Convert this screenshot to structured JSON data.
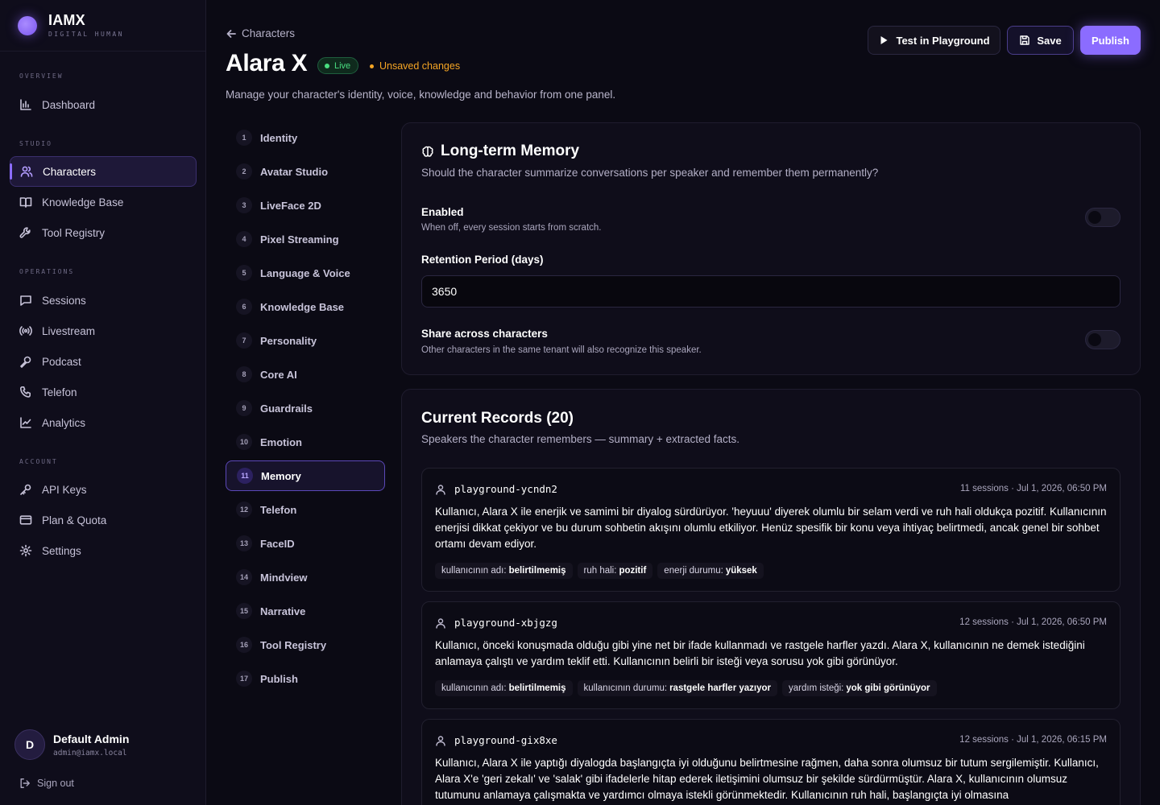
{
  "brand": {
    "name": "IAMX",
    "subtitle": "DIGITAL HUMAN"
  },
  "sidebar": {
    "sections": {
      "overview": "OVERVIEW",
      "studio": "STUDIO",
      "operations": "OPERATIONS",
      "account": "ACCOUNT"
    },
    "items": [
      {
        "label": "Dashboard",
        "icon": "bar-chart-icon"
      },
      {
        "label": "Characters",
        "icon": "users-icon",
        "active": true
      },
      {
        "label": "Knowledge Base",
        "icon": "book-icon"
      },
      {
        "label": "Tool Registry",
        "icon": "wrench-icon"
      },
      {
        "label": "Sessions",
        "icon": "chat-icon"
      },
      {
        "label": "Livestream",
        "icon": "broadcast-icon"
      },
      {
        "label": "Podcast",
        "icon": "microphone-icon"
      },
      {
        "label": "Telefon",
        "icon": "phone-icon"
      },
      {
        "label": "Analytics",
        "icon": "line-chart-icon"
      },
      {
        "label": "API Keys",
        "icon": "key-icon"
      },
      {
        "label": "Plan & Quota",
        "icon": "credit-card-icon"
      },
      {
        "label": "Settings",
        "icon": "gear-icon"
      }
    ],
    "user": {
      "initial": "D",
      "name": "Default Admin",
      "email": "admin@iamx.local"
    },
    "signout": "Sign out"
  },
  "header": {
    "back": "Characters",
    "title": "Alara X",
    "live_badge": "Live",
    "unsaved": "Unsaved changes",
    "description": "Manage your character's identity, voice, knowledge and behavior from one panel.",
    "buttons": {
      "playground": "Test in Playground",
      "save": "Save",
      "publish": "Publish"
    }
  },
  "steps": [
    {
      "num": "1",
      "label": "Identity"
    },
    {
      "num": "2",
      "label": "Avatar Studio"
    },
    {
      "num": "3",
      "label": "LiveFace 2D"
    },
    {
      "num": "4",
      "label": "Pixel Streaming"
    },
    {
      "num": "5",
      "label": "Language & Voice"
    },
    {
      "num": "6",
      "label": "Knowledge Base"
    },
    {
      "num": "7",
      "label": "Personality"
    },
    {
      "num": "8",
      "label": "Core AI"
    },
    {
      "num": "9",
      "label": "Guardrails"
    },
    {
      "num": "10",
      "label": "Emotion"
    },
    {
      "num": "11",
      "label": "Memory",
      "active": true
    },
    {
      "num": "12",
      "label": "Telefon"
    },
    {
      "num": "13",
      "label": "FaceID"
    },
    {
      "num": "14",
      "label": "Mindview"
    },
    {
      "num": "15",
      "label": "Narrative"
    },
    {
      "num": "16",
      "label": "Tool Registry"
    },
    {
      "num": "17",
      "label": "Publish"
    }
  ],
  "memory": {
    "title": "Long-term Memory",
    "subtitle": "Should the character summarize conversations per speaker and remember them permanently?",
    "enabled": {
      "label": "Enabled",
      "help": "When off, every session starts from scratch.",
      "value": false
    },
    "retention": {
      "label": "Retention Period (days)",
      "value": "3650"
    },
    "share": {
      "label": "Share across characters",
      "help": "Other characters in the same tenant will also recognize this speaker.",
      "value": false
    }
  },
  "records": {
    "title": "Current Records (20)",
    "subtitle": "Speakers the character remembers — summary + extracted facts.",
    "items": [
      {
        "id": "playground-ycndn2",
        "meta": "11 sessions · Jul 1, 2026, 06:50 PM",
        "summary": "Kullanıcı, Alara X ile enerjik ve samimi bir diyalog sürdürüyor. 'heyuuu' diyerek olumlu bir selam verdi ve ruh hali oldukça pozitif. Kullanıcının enerjisi dikkat çekiyor ve bu durum sohbetin akışını olumlu etkiliyor. Henüz spesifik bir konu veya ihtiyaç belirtmedi, ancak genel bir sohbet ortamı devam ediyor.",
        "tags": [
          {
            "key": "kullanıcının adı:",
            "value": "belirtilmemiş"
          },
          {
            "key": "ruh hali:",
            "value": "pozitif"
          },
          {
            "key": "enerji durumu:",
            "value": "yüksek"
          }
        ]
      },
      {
        "id": "playground-xbjgzg",
        "meta": "12 sessions · Jul 1, 2026, 06:50 PM",
        "summary": "Kullanıcı, önceki konuşmada olduğu gibi yine net bir ifade kullanmadı ve rastgele harfler yazdı. Alara X, kullanıcının ne demek istediğini anlamaya çalıştı ve yardım teklif etti. Kullanıcının belirli bir isteği veya sorusu yok gibi görünüyor.",
        "tags": [
          {
            "key": "kullanıcının adı:",
            "value": "belirtilmemiş"
          },
          {
            "key": "kullanıcının durumu:",
            "value": "rastgele harfler yazıyor"
          },
          {
            "key": "yardım isteği:",
            "value": "yok gibi görünüyor"
          }
        ]
      },
      {
        "id": "playground-gix8xe",
        "meta": "12 sessions · Jul 1, 2026, 06:15 PM",
        "summary": "Kullanıcı, Alara X ile yaptığı diyalogda başlangıçta iyi olduğunu belirtmesine rağmen, daha sonra olumsuz bir tutum sergilemiştir. Kullanıcı, Alara X'e 'geri zekalı' ve 'salak' gibi ifadelerle hitap ederek iletişimini olumsuz bir şekilde sürdürmüştür. Alara X, kullanıcının olumsuz tutumunu anlamaya çalışmakta ve yardımcı olmaya istekli görünmektedir. Kullanıcının ruh hali, başlangıçta iyi olmasına",
        "tags": []
      }
    ]
  },
  "colors": {
    "accent": "#8b6cff",
    "live": "#4ade80",
    "warning": "#f5a524",
    "background": "#0b0a14"
  }
}
